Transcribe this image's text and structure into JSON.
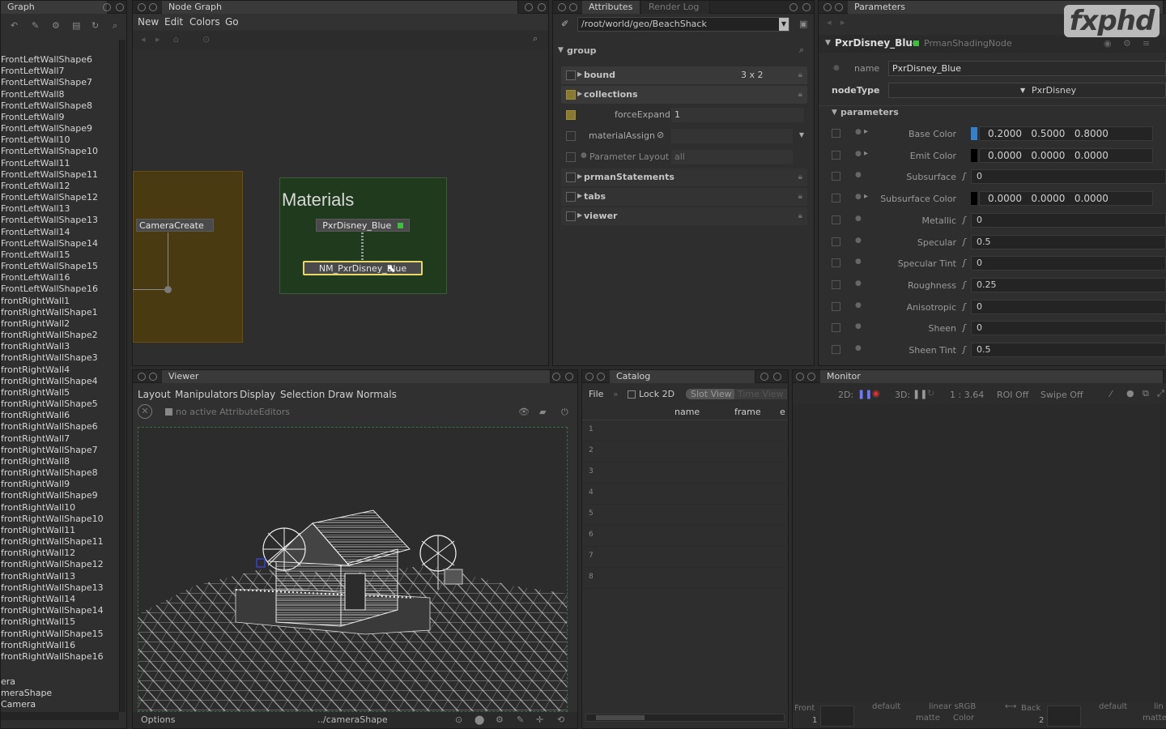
{
  "scene_graph": {
    "tab": "Graph",
    "items": [
      "FrontLeftWallShape6",
      "FrontLeftWall7",
      "FrontLeftWallShape7",
      "FrontLeftWall8",
      "FrontLeftWallShape8",
      "FrontLeftWall9",
      "FrontLeftWallShape9",
      "FrontLeftWall10",
      "FrontLeftWallShape10",
      "FrontLeftWall11",
      "FrontLeftWallShape11",
      "FrontLeftWall12",
      "FrontLeftWallShape12",
      "FrontLeftWall13",
      "FrontLeftWallShape13",
      "FrontLeftWall14",
      "FrontLeftWallShape14",
      "FrontLeftWall15",
      "FrontLeftWallShape15",
      "FrontLeftWall16",
      "FrontLeftWallShape16",
      "frontRightWall1",
      "frontRightWallShape1",
      "frontRightWall2",
      "frontRightWallShape2",
      "frontRightWall3",
      "frontRightWallShape3",
      "frontRightWall4",
      "frontRightWallShape4",
      "frontRightWall5",
      "frontRightWallShape5",
      "frontRightWall6",
      "frontRightWallShape6",
      "frontRightWall7",
      "frontRightWallShape7",
      "frontRightWall8",
      "frontRightWallShape8",
      "frontRightWall9",
      "frontRightWallShape9",
      "frontRightWall10",
      "frontRightWallShape10",
      "frontRightWall11",
      "frontRightWallShape11",
      "frontRightWall12",
      "frontRightWallShape12",
      "frontRightWall13",
      "frontRightWallShape13",
      "frontRightWall14",
      "frontRightWallShape14",
      "frontRightWall15",
      "frontRightWallShape15",
      "frontRightWall16",
      "frontRightWallShape16"
    ],
    "tail_items": [
      "era",
      "meraShape",
      "Camera"
    ]
  },
  "node_graph": {
    "tab": "Node Graph",
    "menu": [
      "New",
      "Edit",
      "Colors",
      "Go"
    ],
    "backdrop_title": "Materials",
    "nodes": {
      "camera": "CameraCreate",
      "material": "PxrDisney_Blue",
      "network": "NM_PxrDisney_Blue"
    }
  },
  "attributes": {
    "tabs": [
      "Attributes",
      "Render Log"
    ],
    "path": "/root/world/geo/BeachShack",
    "group_label": "group",
    "rows": {
      "bound": "bound",
      "bound_value": "3 x 2",
      "collections": "collections",
      "force_expand": "forceExpand",
      "force_expand_value": "1",
      "material_assign": "materialAssign",
      "parameter_layout": "Parameter Layout",
      "parameter_layout_value": "all",
      "prman_statements": "prmanStatements",
      "tabs": "tabs",
      "viewer": "viewer"
    }
  },
  "parameters": {
    "tab": "Parameters",
    "node_name": "PxrDisney_Blue",
    "node_type_label": "PrmanShadingNode",
    "name_label": "name",
    "name_value": "PxrDisney_Blue",
    "node_type_field_label": "nodeType",
    "node_type_value": "PxrDisney",
    "section": "parameters",
    "params": [
      {
        "label": "Base Color",
        "value": "0.2000   0.5000   0.8000",
        "swatch": "#3380cc"
      },
      {
        "label": "Emit Color",
        "value": "0.0000   0.0000   0.0000",
        "swatch": "#000000"
      },
      {
        "label": "Subsurface",
        "value": "0"
      },
      {
        "label": "Subsurface Color",
        "value": "0.0000   0.0000   0.0000",
        "swatch": "#000000"
      },
      {
        "label": "Metallic",
        "value": "0"
      },
      {
        "label": "Specular",
        "value": "0.5"
      },
      {
        "label": "Specular Tint",
        "value": "0"
      },
      {
        "label": "Roughness",
        "value": "0.25"
      },
      {
        "label": "Anisotropic",
        "value": "0"
      },
      {
        "label": "Sheen",
        "value": "0"
      },
      {
        "label": "Sheen Tint",
        "value": "0.5"
      }
    ]
  },
  "viewer": {
    "tab": "Viewer",
    "menu": [
      "Layout",
      "Manipulators",
      "Display",
      "Selection",
      "Draw Normals"
    ],
    "status": "no active AttributeEditors",
    "footer_left": "Options",
    "footer_center": "../cameraShape"
  },
  "catalog": {
    "tab": "Catalog",
    "menu_file": "File",
    "lock": "Lock 2D",
    "slot_view": "Slot View",
    "time_view": "Time View",
    "col_name": "name",
    "col_frame": "frame",
    "col_e": "e",
    "rows": [
      "1",
      "2",
      "3",
      "4",
      "5",
      "6",
      "7",
      "8"
    ]
  },
  "monitor": {
    "tab": "Monitor",
    "toolbar": {
      "twod": "2D:",
      "threed": "3D:",
      "ratio": "1 : 3.64",
      "roi": "ROI Off",
      "swipe": "Swipe Off"
    },
    "footer": {
      "front": "Front",
      "front_num": "1",
      "default1": "default",
      "linear": "linear sRGB",
      "matte": "matte",
      "color": "Color",
      "back": "Back",
      "back_num": "2",
      "default2": "default",
      "lin": "lin",
      "matte2": "matte"
    }
  },
  "watermark": "fxphd"
}
